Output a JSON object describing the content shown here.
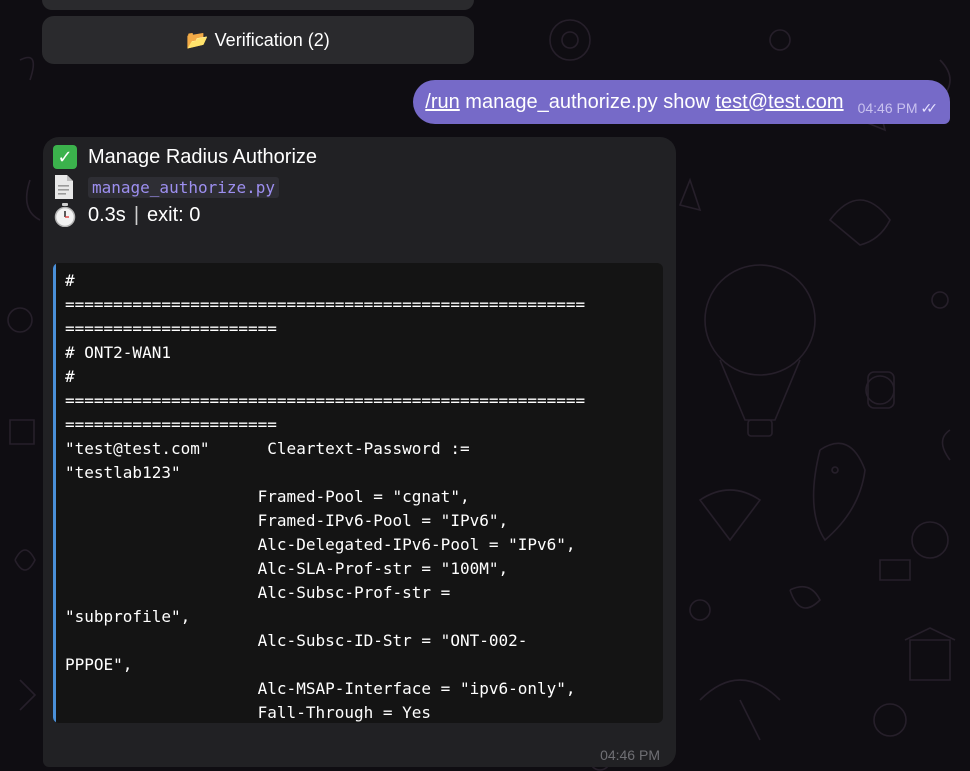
{
  "keyboard": {
    "button_label": "Verification (2)",
    "button_icon": "folder-icon"
  },
  "outgoing": {
    "command": "/run",
    "text": " manage_authorize.py show ",
    "email": "test@test.com",
    "time": "04:46 PM",
    "status_icon": "double-check-icon"
  },
  "incoming": {
    "title": "Manage Radius Authorize",
    "title_icon": "check-mark-icon",
    "file_icon": "document-icon",
    "filename": "manage_authorize.py",
    "timer_icon": "stopwatch-icon",
    "duration": "0.3s",
    "separator": "|",
    "exit": "exit: 0",
    "code": "#\n======================================================\n======================\n# ONT2-WAN1\n#\n======================================================\n======================\n\"test@test.com\"      Cleartext-Password :=\n\"testlab123\"\n                    Framed-Pool = \"cgnat\",\n                    Framed-IPv6-Pool = \"IPv6\",\n                    Alc-Delegated-IPv6-Pool = \"IPv6\",\n                    Alc-SLA-Prof-str = \"100M\",\n                    Alc-Subsc-Prof-str =\n\"subprofile\",\n                    Alc-Subsc-ID-Str = \"ONT-002-\nPPPOE\",\n                    Alc-MSAP-Interface = \"ipv6-only\",\n                    Fall-Through = Yes",
    "time": "04:46 PM"
  },
  "colors": {
    "background": "#0f0d12",
    "outgoing_bubble": "#766ac8",
    "incoming_bubble": "#212124",
    "code_bg": "#141414",
    "code_accent": "#4a90d9",
    "filename": "#9d8ff0"
  }
}
